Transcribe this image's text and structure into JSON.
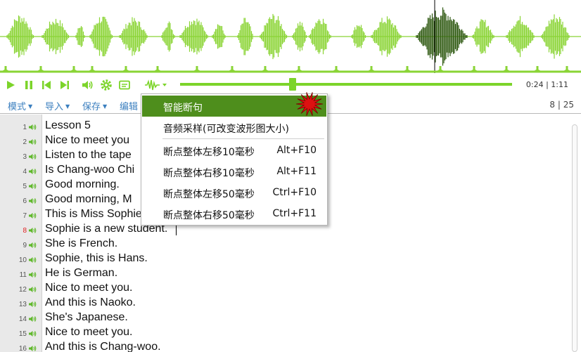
{
  "colors": {
    "accent": "#7cd42a",
    "wave": "#8ad435",
    "wave_dark": "#2f5a12",
    "menu_text": "#3b7fbf",
    "highlight": "#4e8e1c",
    "current_line": "#e02020",
    "burst": "#dd1111"
  },
  "toolbar": {
    "play_icon": "play-icon",
    "pause_icon": "pause-icon",
    "prev_icon": "skip-back-icon",
    "next_icon": "skip-forward-icon",
    "volume_icon": "volume-icon",
    "settings_icon": "gear-icon",
    "subtitle_icon": "subtitle-icon",
    "wave_menu_icon": "waveform-icon",
    "time": "0:24 | 1:11",
    "progress": 0.34
  },
  "menubar": {
    "mode": "模式",
    "import": "导入",
    "save": "保存",
    "edit": "编辑",
    "page_counter": "8 | 25"
  },
  "context_menu": {
    "items": [
      {
        "label": "智能断句",
        "shortcut": ""
      },
      {
        "label": "音频采样(可改变波形图大小)",
        "shortcut": ""
      },
      {
        "label": "断点整体左移10毫秒",
        "shortcut": "Alt+F10"
      },
      {
        "label": "断点整体右移10毫秒",
        "shortcut": "Alt+F11"
      },
      {
        "label": "断点整体左移50毫秒",
        "shortcut": "Ctrl+F10"
      },
      {
        "label": "断点整体右移50毫秒",
        "shortcut": "Ctrl+F11"
      }
    ]
  },
  "editor": {
    "current_line": 8,
    "lines": [
      {
        "no": "1",
        "text": "Lesson 5"
      },
      {
        "no": "2",
        "text": "Nice to meet you"
      },
      {
        "no": "3",
        "text": "Listen to the tape"
      },
      {
        "no": "4",
        "text": "Is Chang-woo Chi"
      },
      {
        "no": "5",
        "text": "Good morning."
      },
      {
        "no": "6",
        "text": "Good morning, M"
      },
      {
        "no": "7",
        "text": "This is Miss Sophie"
      },
      {
        "no": "8",
        "text": "Sophie is a new student."
      },
      {
        "no": "9",
        "text": "She is French."
      },
      {
        "no": "10",
        "text": "Sophie, this is Hans."
      },
      {
        "no": "11",
        "text": "He is German."
      },
      {
        "no": "12",
        "text": "Nice to meet you."
      },
      {
        "no": "13",
        "text": "And this is Naoko."
      },
      {
        "no": "14",
        "text": "She's Japanese."
      },
      {
        "no": "15",
        "text": "Nice to meet you."
      },
      {
        "no": "16",
        "text": "And this is Chang-woo."
      }
    ]
  }
}
